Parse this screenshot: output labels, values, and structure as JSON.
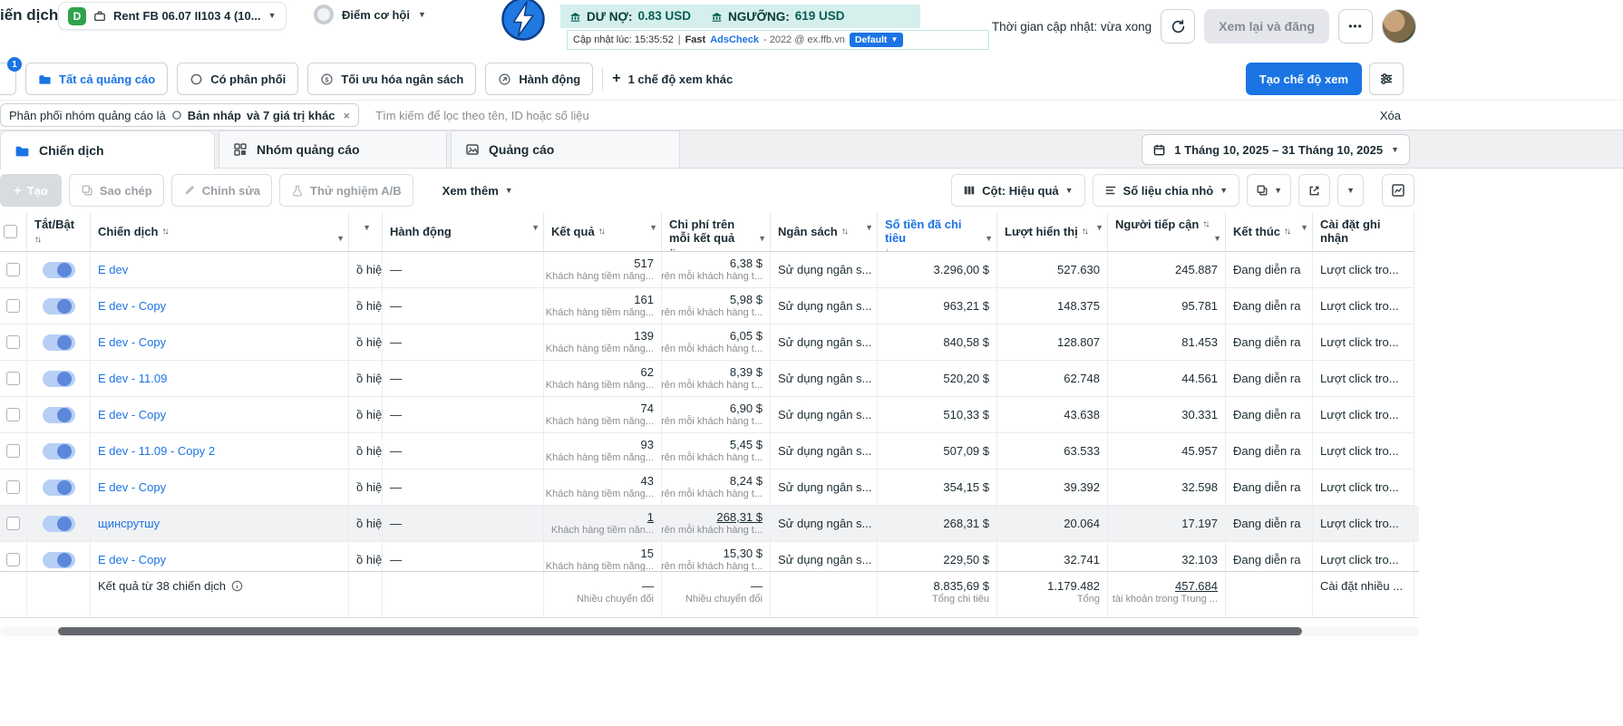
{
  "topbar": {
    "page_title": "iến dịch",
    "account": {
      "badge": "D",
      "label": "Rent FB 06.07 II103 4 (10..."
    },
    "opportunity_label": "Điểm cơ hội",
    "balance": {
      "debt_label": "DƯ NỢ:",
      "debt_value": "0.83 USD",
      "threshold_label": "NGƯỠNG:",
      "threshold_value": "619 USD"
    },
    "adscheck": {
      "updated": "Cập nhật lúc: 15:35:52",
      "sep": "|",
      "brand_bold": "Fast",
      "brand_link": "AdsCheck",
      "brand_tail": "- 2022 @ ex.ffb.vn",
      "default_btn": "Default",
      "mini_buttons": [
        "✕",
        "↗",
        "↻",
        "—"
      ]
    },
    "refresh_status": "Thời gian cập nhật: vừa xong",
    "review_button": "Xem lại và đăng",
    "more_button": "•••"
  },
  "view_bar": {
    "search_badge": "1",
    "tab_all": "Tất cả quảng cáo",
    "tab_delivery": "Có phân phối",
    "tab_budget": "Tối ưu hóa ngân sách",
    "tab_action": "Hành động",
    "more_views": "1 chế độ xem khác",
    "create_view": "Tạo chế độ xem"
  },
  "filter_bar": {
    "chip_prefix": "Phân phối nhóm quảng cáo là",
    "chip_value": "Bản nháp",
    "chip_more": "và 7 giá trị khác",
    "chip_close": "×",
    "search_placeholder": "Tìm kiếm để lọc theo tên, ID hoặc số liệu",
    "clear": "Xóa"
  },
  "level_tabs": {
    "campaigns": "Chiến dịch",
    "adsets": "Nhóm quảng cáo",
    "ads": "Quảng cáo",
    "date_range": "1 Tháng 10, 2025 – 31 Tháng 10, 2025"
  },
  "toolbar": {
    "create": "Tạo",
    "duplicate": "Sao chép",
    "edit": "Chỉnh sửa",
    "ab_test": "Thử nghiệm A/B",
    "more": "Xem thêm",
    "columns": "Cột: Hiệu quả",
    "breakdown": "Số liệu chia nhỏ"
  },
  "table": {
    "headers": {
      "toggle": "Tắt/Bật",
      "name": "Chiến dịch",
      "action": "Hành động",
      "result": "Kết quả",
      "cpr": "Chi phí trên mỗi kết quả",
      "budget": "Ngân sách",
      "spent": "Số tiền đã chi tiêu",
      "impressions": "Lượt hiển thị",
      "reach": "Người tiếp cận",
      "end": "Kết thúc",
      "attribution": "Cài đặt ghi nhận"
    },
    "rows": [
      {
        "name": "E dev",
        "frag": "ồ hiệu",
        "action": "—",
        "result": "517",
        "result_sub": "Khách hàng tiềm năng...",
        "cpr": "6,38 $",
        "cpr_sub": "Trên mỗi khách hàng t...",
        "budget": "Sử dụng ngân s...",
        "spent": "3.296,00 $",
        "impressions": "527.630",
        "reach": "245.887",
        "end": "Đang diễn ra",
        "attribution": "Lượt click tro..."
      },
      {
        "name": "E dev - Copy",
        "frag": "ồ hiệu",
        "action": "—",
        "result": "161",
        "result_sub": "Khách hàng tiềm năng...",
        "cpr": "5,98 $",
        "cpr_sub": "Trên mỗi khách hàng t...",
        "budget": "Sử dụng ngân s...",
        "spent": "963,21 $",
        "impressions": "148.375",
        "reach": "95.781",
        "end": "Đang diễn ra",
        "attribution": "Lượt click tro..."
      },
      {
        "name": "E dev - Copy",
        "frag": "ồ hiệu",
        "action": "—",
        "result": "139",
        "result_sub": "Khách hàng tiềm năng...",
        "cpr": "6,05 $",
        "cpr_sub": "Trên mỗi khách hàng t...",
        "budget": "Sử dụng ngân s...",
        "spent": "840,58 $",
        "impressions": "128.807",
        "reach": "81.453",
        "end": "Đang diễn ra",
        "attribution": "Lượt click tro..."
      },
      {
        "name": "E dev - 11.09",
        "frag": "ồ hiệu",
        "action": "—",
        "result": "62",
        "result_sub": "Khách hàng tiềm năng...",
        "cpr": "8,39 $",
        "cpr_sub": "Trên mỗi khách hàng t...",
        "budget": "Sử dụng ngân s...",
        "spent": "520,20 $",
        "impressions": "62.748",
        "reach": "44.561",
        "end": "Đang diễn ra",
        "attribution": "Lượt click tro..."
      },
      {
        "name": "E dev - Copy",
        "frag": "ồ hiệu",
        "action": "—",
        "result": "74",
        "result_sub": "Khách hàng tiềm năng...",
        "cpr": "6,90 $",
        "cpr_sub": "Trên mỗi khách hàng t...",
        "budget": "Sử dụng ngân s...",
        "spent": "510,33 $",
        "impressions": "43.638",
        "reach": "30.331",
        "end": "Đang diễn ra",
        "attribution": "Lượt click tro..."
      },
      {
        "name": "E dev - 11.09 - Copy 2",
        "frag": "ồ hiệu",
        "action": "—",
        "result": "93",
        "result_sub": "Khách hàng tiềm năng...",
        "cpr": "5,45 $",
        "cpr_sub": "Trên mỗi khách hàng t...",
        "budget": "Sử dụng ngân s...",
        "spent": "507,09 $",
        "impressions": "63.533",
        "reach": "45.957",
        "end": "Đang diễn ra",
        "attribution": "Lượt click tro..."
      },
      {
        "name": "E dev - Copy",
        "frag": "ồ hiệu",
        "action": "—",
        "result": "43",
        "result_sub": "Khách hàng tiềm năng...",
        "cpr": "8,24 $",
        "cpr_sub": "Trên mỗi khách hàng t...",
        "budget": "Sử dụng ngân s...",
        "spent": "354,15 $",
        "impressions": "39.392",
        "reach": "32.598",
        "end": "Đang diễn ra",
        "attribution": "Lượt click tro..."
      },
      {
        "name": "щинсрутшу",
        "frag": "ồ hiệu",
        "action": "—",
        "result": "1",
        "result_sub": "Khách hàng tiềm năn...",
        "cpr": "268,31 $",
        "cpr_sub": "Trên mỗi khách hàng t...",
        "budget": "Sử dụng ngân s...",
        "spent": "268,31 $",
        "impressions": "20.064",
        "reach": "17.197",
        "end": "Đang diễn ra",
        "attribution": "Lượt click tro...",
        "highlight": true,
        "underline": true
      },
      {
        "name": "E dev - Copy",
        "frag": "ồ hiệu",
        "action": "—",
        "result": "15",
        "result_sub": "Khách hàng tiềm năng...",
        "cpr": "15,30 $",
        "cpr_sub": "Trên mỗi khách hàng t...",
        "budget": "Sử dụng ngân s...",
        "spent": "229,50 $",
        "impressions": "32.741",
        "reach": "32.103",
        "end": "Đang diễn ra",
        "attribution": "Lượt click tro..."
      }
    ],
    "footer": {
      "summary": "Kết quả từ 38 chiến dịch",
      "result": "—",
      "result_sub": "Nhiều chuyển đổi",
      "cpr": "—",
      "cpr_sub": "Nhiều chuyển đổi",
      "spent": "8.835,69 $",
      "spent_sub": "Tổng chi tiêu",
      "impressions": "1.179.482",
      "impressions_sub": "Tổng",
      "reach": "457.684",
      "reach_sub": "tài khoản trong Trung ...",
      "attribution": "Cài đặt nhiều ..."
    }
  }
}
